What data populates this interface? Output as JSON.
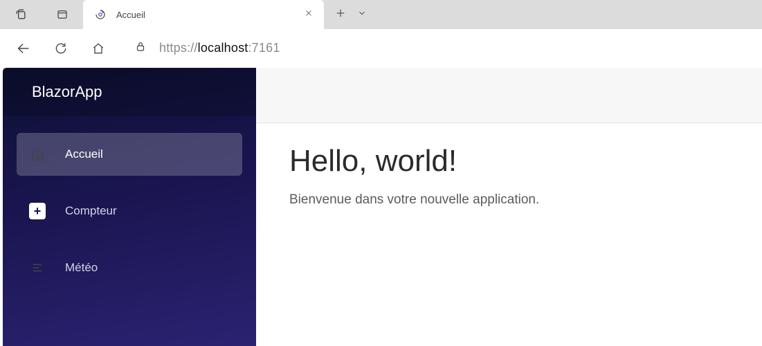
{
  "browser": {
    "tab_title": "Accueil",
    "url_scheme": "https://",
    "url_host1": "localhost",
    "url_host2": ":7161"
  },
  "sidebar": {
    "brand": "BlazorApp",
    "items": [
      {
        "label": "Accueil"
      },
      {
        "label": "Compteur"
      },
      {
        "label": "Météo"
      }
    ]
  },
  "page": {
    "heading": "Hello, world!",
    "subheading": "Bienvenue dans votre nouvelle application."
  }
}
